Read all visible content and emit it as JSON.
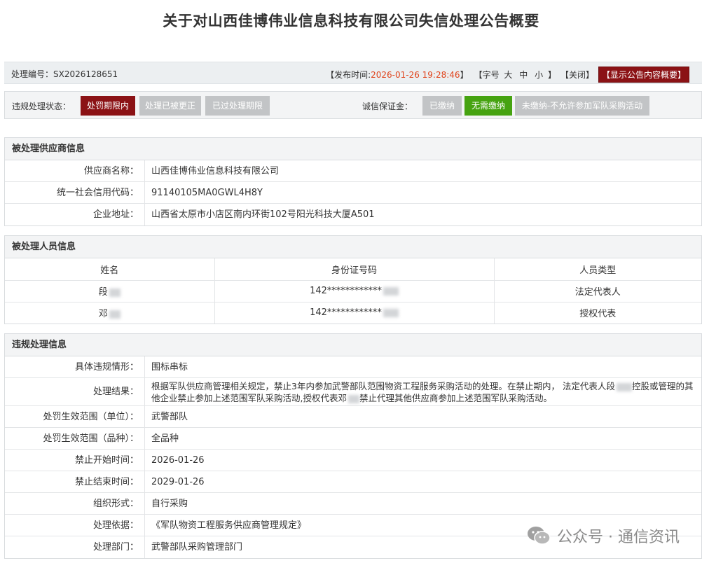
{
  "title": "关于对山西佳博伟业信息科技有限公司失信处理公告概要",
  "infobar": {
    "code": "处理编号：SX2026128651",
    "pub_prefix": "【发布时间:",
    "pub_time": "2026-01-26 19:28:46",
    "pub_suffix": "】",
    "font_prefix": "【字号",
    "font_large": "大",
    "font_mid": "中",
    "font_small": "小",
    "font_suffix": "】",
    "close": "【关闭】",
    "show_summary": "【显示公告内容概要】"
  },
  "status": {
    "label": "违规处理状态：",
    "items": [
      "处罚期限内",
      "处理已被更正",
      "已过处理期限"
    ],
    "deposit_label": "诚信保证金：",
    "deposit_items": [
      "已缴纳",
      "无需缴纳",
      "未缴纳-不允许参加军队采购活动"
    ]
  },
  "supplier": {
    "header": "被处理供应商信息",
    "rows": [
      {
        "key": "供应商名称：",
        "value": "山西佳博伟业信息科技有限公司"
      },
      {
        "key": "统一社会信用代码：",
        "value": "91140105MA0GWL4H8Y"
      },
      {
        "key": "企业地址：",
        "value": "山西省太原市小店区南内环街102号阳光科技大厦A501"
      }
    ]
  },
  "people": {
    "header": "被处理人员信息",
    "columns": [
      "姓名",
      "身份证号码",
      "人员类型"
    ],
    "rows": [
      {
        "name": "段",
        "id": "142************",
        "type": "法定代表人"
      },
      {
        "name": "邓",
        "id": "142************",
        "type": "授权代表"
      }
    ]
  },
  "violation": {
    "header": "违规处理信息",
    "rows": [
      {
        "key": "具体违规情形：",
        "value": "围标串标"
      },
      {
        "key": "处理结果：",
        "value_a": "根据军队供应商管理相关规定，禁止3年内参加武警部队范围物资工程服务采购活动的处理。在禁止期内， 法定代表人段",
        "value_b": "控股或管理的其他企业禁止参加上述范围军队采购活动,授权代表邓",
        "value_c": "禁止代理其他供应商参加上述范围军队采购活动。"
      },
      {
        "key": "处罚生效范围（单位）：",
        "value": "武警部队"
      },
      {
        "key": "处罚生效范围（品种）：",
        "value": "全品种"
      },
      {
        "key": "禁止开始时间：",
        "value": "2026-01-26"
      },
      {
        "key": "禁止结束时间：",
        "value": "2029-01-26"
      },
      {
        "key": "组织形式：",
        "value": "自行采购"
      },
      {
        "key": "处理依据：",
        "value": "《军队物资工程服务供应商管理规定》"
      },
      {
        "key": "处理部门：",
        "value": "武警部队采购管理部门"
      }
    ]
  },
  "watermark": "公众号 · 通信资讯"
}
